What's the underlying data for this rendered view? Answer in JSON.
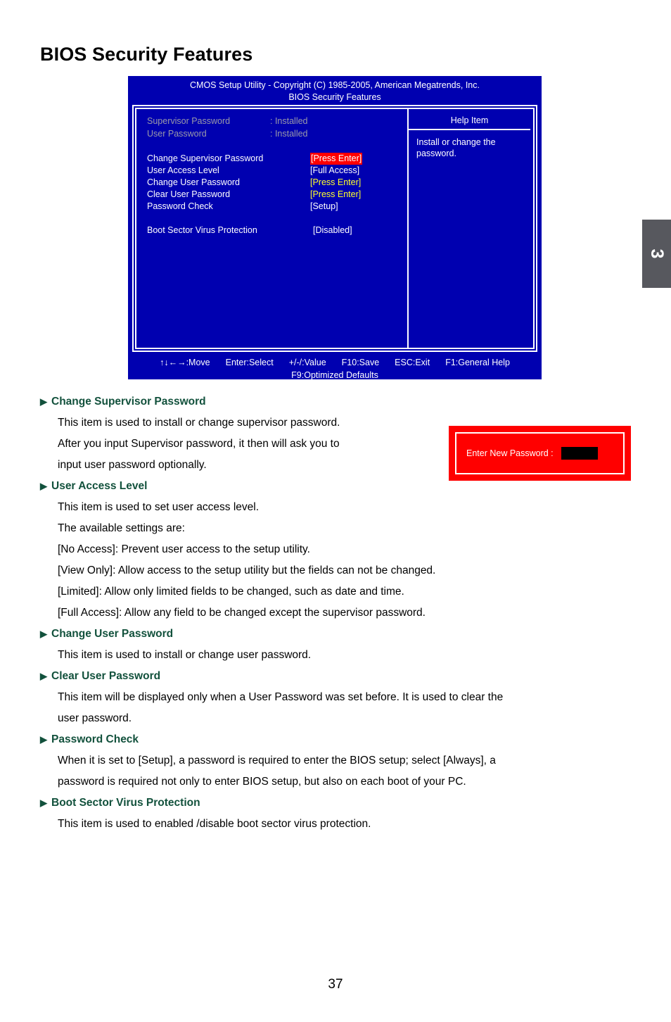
{
  "page": {
    "title": "BIOS Security Features",
    "number": "37",
    "chapter_tab": "3"
  },
  "bios": {
    "title_line1": "CMOS Setup Utility - Copyright (C) 1985-2005, American Megatrends, Inc.",
    "title_line2": "BIOS Security Features",
    "status_rows": [
      {
        "label": "Supervisor Password",
        "value": ": Installed"
      },
      {
        "label": "User Password",
        "value": ": Installed"
      }
    ],
    "items": [
      {
        "label": "Change Supervisor Password",
        "value": "[Press Enter]",
        "style": "selected"
      },
      {
        "label": "User Access Level",
        "value": "[Full Access]",
        "style": "white"
      },
      {
        "label": "Change User Password",
        "value": "[Press Enter]",
        "style": "yellow"
      },
      {
        "label": "Clear User Password",
        "value": "[Press Enter]",
        "style": "yellow"
      },
      {
        "label": "Password Check",
        "value": "[Setup]",
        "style": "white"
      }
    ],
    "extra_item": {
      "label": "Boot Sector Virus Protection",
      "value": "[Disabled]"
    },
    "help": {
      "title": "Help Item",
      "line1": "Install or change the",
      "line2": "password."
    },
    "footer": {
      "keys": [
        "↑↓←→:Move",
        "Enter:Select",
        "+/-/:Value",
        "F10:Save",
        "ESC:Exit",
        "F1:General Help"
      ],
      "second_line": "F9:Optimized Defaults"
    },
    "colors": {
      "background": "#0000b0",
      "selected_highlight": "#ff0000",
      "value_yellow": "#ffff2a",
      "dimmed_text": "#9a9aa8"
    }
  },
  "password_dialog": {
    "label": "Enter New Password :",
    "field_value": "",
    "border_color": "#ff0000"
  },
  "sections": [
    {
      "heading": "Change Supervisor Password",
      "paragraphs": [
        "This item is used to install or change supervisor password.",
        "After you input Supervisor password, it then will ask you to",
        "input user password optionally."
      ]
    },
    {
      "heading": "User Access Level",
      "paragraphs": [
        "This item is used to set user access level.",
        "The available settings are:",
        "[No Access]: Prevent user access to the setup utility.",
        "[View Only]: Allow access to the setup utility but the fields can not be changed.",
        "[Limited]: Allow only limited fields to be changed, such as date and time.",
        "[Full Access]: Allow any field to be changed except the supervisor password."
      ]
    },
    {
      "heading": "Change User Password",
      "paragraphs": [
        "This item is used to install or change user password."
      ]
    },
    {
      "heading": "Clear User Password",
      "paragraphs": [
        "This item will be displayed only when a User Password was set before. It is used to clear the",
        "user password."
      ]
    },
    {
      "heading": "Password Check",
      "paragraphs": [
        "When it is set to [Setup], a password is required to enter the BIOS setup; select [Always], a",
        "password is required not only to enter BIOS setup, but also on each boot of your PC."
      ]
    },
    {
      "heading": "Boot Sector Virus Protection",
      "paragraphs": [
        "This item is used to enabled /disable boot sector virus protection."
      ]
    }
  ],
  "icons": {
    "bullet_triangle": "▶"
  }
}
